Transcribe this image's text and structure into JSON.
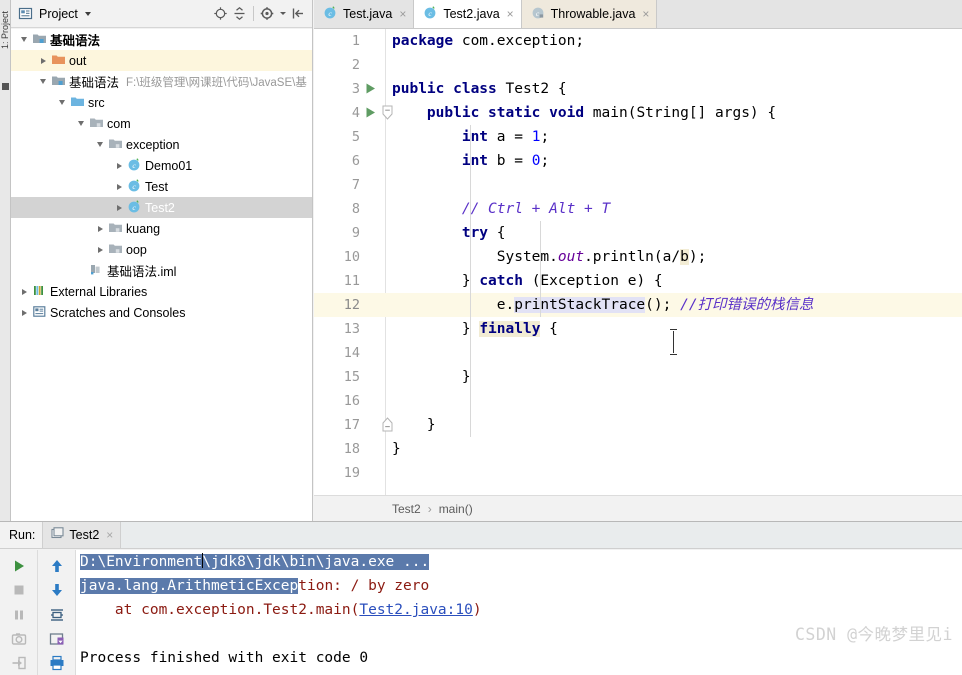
{
  "window": {
    "left_stripe_label": "1: Project"
  },
  "project_panel": {
    "title": "Project",
    "icons": [
      "project-view-icon",
      "locate-icon",
      "collapse-all-icon",
      "settings-gear-icon",
      "hide-panel-icon"
    ],
    "tree": [
      {
        "label": "基础语法",
        "sub": "",
        "indent": 0,
        "arrow": "down",
        "icon": "module-folder-icon",
        "state": "normal",
        "bold": true
      },
      {
        "label": "out",
        "sub": "",
        "indent": 1,
        "arrow": "right",
        "icon": "excluded-folder-icon",
        "state": "excluded",
        "bold": false
      },
      {
        "label": "基础语法",
        "sub": "F:\\班级管理\\网课班\\代码\\JavaSE\\基",
        "indent": 1,
        "arrow": "down",
        "icon": "module-folder-icon",
        "state": "normal",
        "bold": false
      },
      {
        "label": "src",
        "sub": "",
        "indent": 2,
        "arrow": "down",
        "icon": "source-folder-icon",
        "state": "normal",
        "bold": false
      },
      {
        "label": "com",
        "sub": "",
        "indent": 3,
        "arrow": "down",
        "icon": "package-icon",
        "state": "normal",
        "bold": false
      },
      {
        "label": "exception",
        "sub": "",
        "indent": 4,
        "arrow": "down",
        "icon": "package-icon",
        "state": "normal",
        "bold": false
      },
      {
        "label": "Demo01",
        "sub": "",
        "indent": 5,
        "arrow": "right",
        "icon": "java-class-icon",
        "state": "normal",
        "bold": false
      },
      {
        "label": "Test",
        "sub": "",
        "indent": 5,
        "arrow": "right",
        "icon": "java-class-icon",
        "state": "normal",
        "bold": false
      },
      {
        "label": "Test2",
        "sub": "",
        "indent": 5,
        "arrow": "right",
        "icon": "java-class-icon",
        "state": "selected",
        "bold": false
      },
      {
        "label": "kuang",
        "sub": "",
        "indent": 4,
        "arrow": "right",
        "icon": "package-icon",
        "state": "normal",
        "bold": false
      },
      {
        "label": "oop",
        "sub": "",
        "indent": 4,
        "arrow": "right",
        "icon": "package-icon",
        "state": "normal",
        "bold": false
      },
      {
        "label": "基础语法.iml",
        "sub": "",
        "indent": 3,
        "arrow": "none",
        "icon": "iml-file-icon",
        "state": "normal",
        "bold": false
      },
      {
        "label": "External Libraries",
        "sub": "",
        "indent": 0,
        "arrow": "right",
        "icon": "libraries-icon",
        "state": "normal",
        "bold": false
      },
      {
        "label": "Scratches and Consoles",
        "sub": "",
        "indent": 0,
        "arrow": "right",
        "icon": "scratches-icon",
        "state": "normal",
        "bold": false
      }
    ]
  },
  "editor": {
    "tabs": [
      {
        "label": "Test.java",
        "state": "inactive",
        "icon": "java-class-icon",
        "close": "×"
      },
      {
        "label": "Test2.java",
        "state": "active",
        "icon": "java-class-icon",
        "close": "×"
      },
      {
        "label": "Throwable.java",
        "state": "readonly",
        "icon": "java-class-lib-icon",
        "close": "×"
      }
    ],
    "caret_line": 12,
    "lines": [
      {
        "n": "1",
        "indent": 0,
        "gutter": "none",
        "fold": "none"
      },
      {
        "n": "2",
        "indent": 0,
        "gutter": "none",
        "fold": "none"
      },
      {
        "n": "3",
        "indent": 0,
        "gutter": "run",
        "fold": "none"
      },
      {
        "n": "4",
        "indent": 0,
        "gutter": "run",
        "fold": "collapse"
      },
      {
        "n": "5",
        "indent": 0,
        "gutter": "none",
        "fold": "none"
      },
      {
        "n": "6",
        "indent": 0,
        "gutter": "none",
        "fold": "none"
      },
      {
        "n": "7",
        "indent": 0,
        "gutter": "none",
        "fold": "none"
      },
      {
        "n": "8",
        "indent": 0,
        "gutter": "none",
        "fold": "none"
      },
      {
        "n": "9",
        "indent": 0,
        "gutter": "none",
        "fold": "none"
      },
      {
        "n": "10",
        "indent": 0,
        "gutter": "none",
        "fold": "none"
      },
      {
        "n": "11",
        "indent": 0,
        "gutter": "none",
        "fold": "none"
      },
      {
        "n": "12",
        "indent": 0,
        "gutter": "none",
        "fold": "none"
      },
      {
        "n": "13",
        "indent": 0,
        "gutter": "none",
        "fold": "none"
      },
      {
        "n": "14",
        "indent": 0,
        "gutter": "none",
        "fold": "none"
      },
      {
        "n": "15",
        "indent": 0,
        "gutter": "none",
        "fold": "none"
      },
      {
        "n": "16",
        "indent": 0,
        "gutter": "none",
        "fold": "none"
      },
      {
        "n": "17",
        "indent": 0,
        "gutter": "none",
        "fold": "expand"
      },
      {
        "n": "18",
        "indent": 0,
        "gutter": "none",
        "fold": "none"
      },
      {
        "n": "19",
        "indent": 0,
        "gutter": "none",
        "fold": "none"
      }
    ],
    "source_text": [
      "package com.exception;",
      "",
      "public class Test2 {",
      "    public static void main(String[] args) {",
      "        int a = 1;",
      "        int b = 0;",
      "",
      "        // Ctrl + Alt + T",
      "        try {",
      "            System.out.println(a/b);",
      "        } catch (Exception e) {",
      "            e.printStackTrace(); //打印错误的栈信息",
      "        } finally {",
      "",
      "        }",
      "",
      "    }",
      "}",
      ""
    ],
    "breadcrumb": {
      "class": "Test2",
      "separator": "›",
      "method": "main()"
    }
  },
  "run_panel": {
    "label": "Run:",
    "tab": {
      "label": "Test2",
      "icon": "run-config-icon",
      "close": "×"
    },
    "toolbar_left": [
      "rerun-icon",
      "stop-icon",
      "pause-icon",
      "camera-icon",
      "dump-threads-icon"
    ],
    "toolbar_right": [
      "scroll-up-icon",
      "scroll-down-icon",
      "soft-wrap-icon",
      "export-icon",
      "print-icon"
    ],
    "console": {
      "line1_selected": "D:\\Environment\\jdk8\\jdk\\bin\\java.exe ...",
      "line2_selected_part": "java.lang.ArithmeticExcep",
      "line2_rest": "tion: / by zero",
      "line3_prefix": "    at com.exception.Test2.main(",
      "line3_link": "Test2.java:10",
      "line3_suffix": ")",
      "line4": "",
      "line5": "Process finished with exit code 0"
    },
    "watermark": "CSDN @今晚梦里见i"
  }
}
